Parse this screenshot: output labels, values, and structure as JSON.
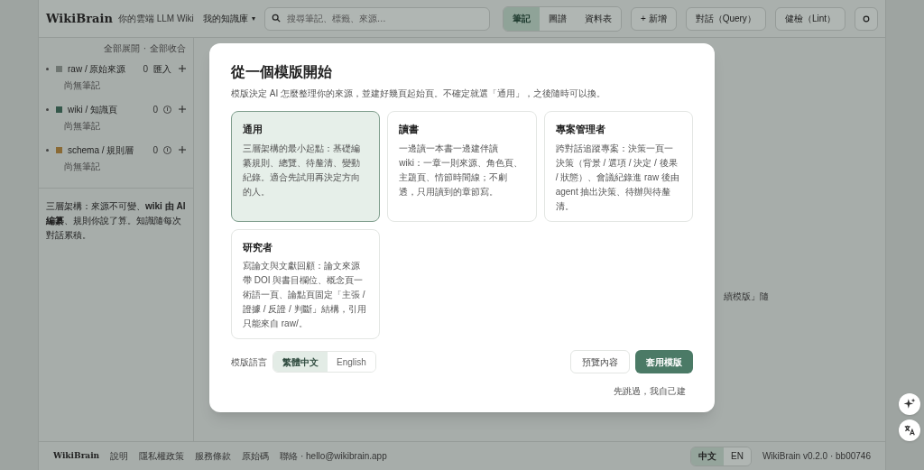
{
  "header": {
    "brand": "WikiBrain",
    "tagline": "你的雲端 LLM Wiki",
    "vault": "我的知識庫",
    "vault_caret": "▾",
    "search": {
      "placeholder": "搜尋筆記、標籤、來源…"
    },
    "views": [
      {
        "label": "筆記",
        "selected": true
      },
      {
        "label": "圖譜",
        "selected": false
      },
      {
        "label": "資料表",
        "selected": false
      }
    ],
    "actions": [
      "+ 新增",
      "對話（Query）",
      "健檢（Lint）"
    ]
  },
  "sidebar": {
    "expand_all": "全部展開",
    "separator": "·",
    "collapse_all": "全部收合",
    "layers": [
      {
        "name": "raw / 原始來源",
        "color": "#6f7672",
        "count": "0",
        "kind": "import",
        "import_label": "匯入",
        "empty": "尚無筆記"
      },
      {
        "name": "wiki / 知識頁",
        "color": "#34574a",
        "count": "0",
        "kind": "info",
        "empty": "尚無筆記"
      },
      {
        "name": "schema / 規則層",
        "color": "#8a6a35",
        "count": "0",
        "kind": "info",
        "empty": "尚無筆記"
      }
    ],
    "note": "三層架構：來源不可變、**wiki 由 AI 編纂**、規則你說了算。知識隨每次對話累積。"
  },
  "main": {
    "peek_text": "續模版」隨"
  },
  "modal": {
    "title": "從一個模版開始",
    "subtitle": "模版決定 AI 怎麼整理你的來源，並建好幾頁起始頁。不確定就選「通用」，之後隨時可以換。",
    "templates": [
      {
        "name": "通用",
        "description": "三層架構的最小起點：基礎編纂規則、總覽、待釐清、變動紀錄。適合先試用再決定方向的人。",
        "selected": true
      },
      {
        "name": "讀書",
        "description": "一邊讀一本書一邊建伴讀 wiki：一章一則來源、角色頁、主題頁、情節時間線；不劇透，只用讀到的章節寫。",
        "selected": false
      },
      {
        "name": "專案管理者",
        "description": "跨對話追蹤專案：決策一頁一決策（背景 / 選項 / 決定 / 後果 / 狀態）、會議紀錄進 raw 後由 agent 抽出決策、待辦與待釐清。",
        "selected": false
      },
      {
        "name": "研究者",
        "description": "寫論文與文獻回顧：論文來源帶 DOI 與書目欄位、概念頁一術語一頁、論點頁固定「主張 / 證據 / 反證 / 判斷」結構，引用只能來自 raw/。",
        "selected": false
      }
    ],
    "language_label": "模版語言",
    "languages": [
      {
        "label": "繁體中文",
        "selected": true
      },
      {
        "label": "English",
        "selected": false
      }
    ],
    "preview_button": "預覽內容",
    "apply_button": "套用模版",
    "skip_link": "先跳過，我自己建"
  },
  "footer": {
    "brand": "WikiBrain",
    "links": [
      "說明",
      "隱私權政策",
      "服務條款",
      "原始碼",
      "聯絡 · hello@wikibrain.app"
    ],
    "locales": [
      {
        "label": "中文",
        "selected": true
      },
      {
        "label": "EN",
        "selected": false
      }
    ],
    "version": "WikiBrain v0.2.0 · bb00746"
  }
}
